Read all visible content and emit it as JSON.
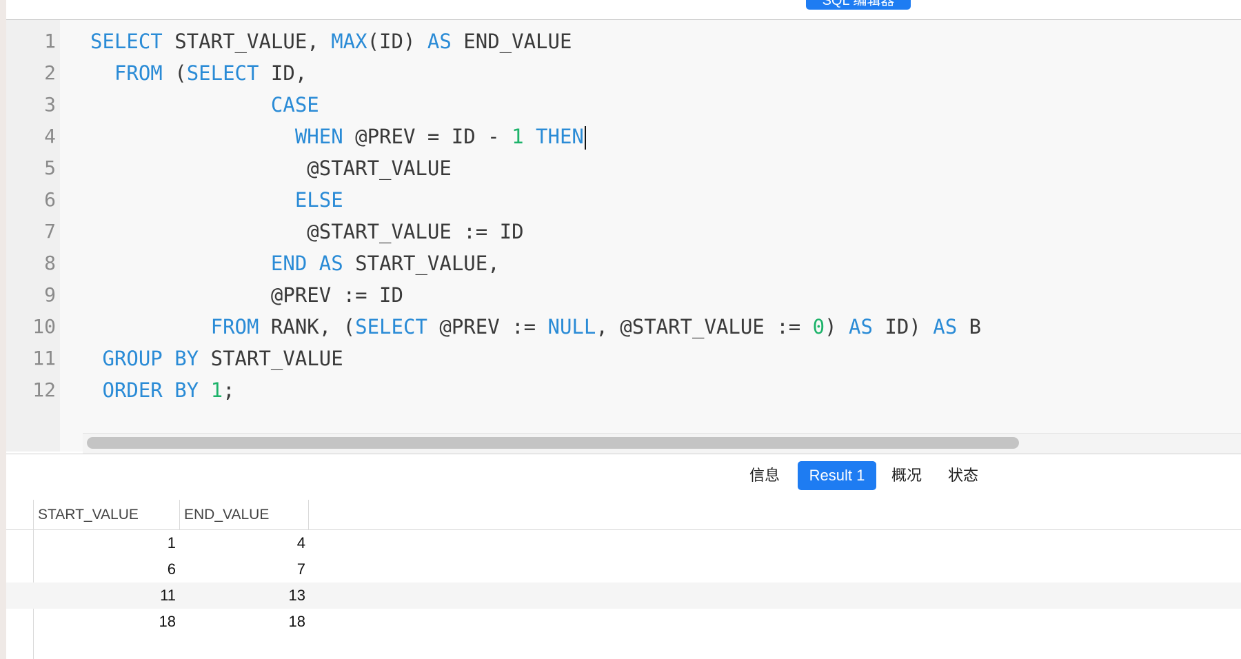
{
  "toolbar": {
    "top_button_label": "SQL 编辑器"
  },
  "editor": {
    "lines": [
      {
        "n": "1",
        "tokens": [
          {
            "t": "SELECT",
            "k": "kw"
          },
          {
            "t": " START_VALUE, "
          },
          {
            "t": "MAX",
            "k": "kw"
          },
          {
            "t": "(ID) "
          },
          {
            "t": "AS",
            "k": "kw"
          },
          {
            "t": " END_VALUE"
          }
        ]
      },
      {
        "n": "2",
        "tokens": [
          {
            "t": "  "
          },
          {
            "t": "FROM",
            "k": "kw"
          },
          {
            "t": " ("
          },
          {
            "t": "SELECT",
            "k": "kw"
          },
          {
            "t": " ID,"
          }
        ]
      },
      {
        "n": "3",
        "tokens": [
          {
            "t": "               "
          },
          {
            "t": "CASE",
            "k": "kw"
          }
        ]
      },
      {
        "n": "4",
        "tokens": [
          {
            "t": "                 "
          },
          {
            "t": "WHEN",
            "k": "kw"
          },
          {
            "t": " @PREV = ID - "
          },
          {
            "t": "1",
            "k": "num"
          },
          {
            "t": " "
          },
          {
            "t": "THEN",
            "k": "kw"
          }
        ],
        "caret": true
      },
      {
        "n": "5",
        "tokens": [
          {
            "t": "                  @START_VALUE"
          }
        ]
      },
      {
        "n": "6",
        "tokens": [
          {
            "t": "                 "
          },
          {
            "t": "ELSE",
            "k": "kw"
          }
        ]
      },
      {
        "n": "7",
        "tokens": [
          {
            "t": "                  @START_VALUE := ID"
          }
        ]
      },
      {
        "n": "8",
        "tokens": [
          {
            "t": "               "
          },
          {
            "t": "END",
            "k": "kw"
          },
          {
            "t": " "
          },
          {
            "t": "AS",
            "k": "kw"
          },
          {
            "t": " START_VALUE,"
          }
        ]
      },
      {
        "n": "9",
        "tokens": [
          {
            "t": "               @PREV := ID"
          }
        ]
      },
      {
        "n": "10",
        "tokens": [
          {
            "t": "          "
          },
          {
            "t": "FROM",
            "k": "kw"
          },
          {
            "t": " RANK, ("
          },
          {
            "t": "SELECT",
            "k": "kw"
          },
          {
            "t": " @PREV := "
          },
          {
            "t": "NULL",
            "k": "kw"
          },
          {
            "t": ", @START_VALUE := "
          },
          {
            "t": "0",
            "k": "num"
          },
          {
            "t": ") "
          },
          {
            "t": "AS",
            "k": "kw"
          },
          {
            "t": " ID) "
          },
          {
            "t": "AS",
            "k": "kw"
          },
          {
            "t": " B"
          }
        ]
      },
      {
        "n": "11",
        "tokens": [
          {
            "t": " "
          },
          {
            "t": "GROUP BY",
            "k": "kw"
          },
          {
            "t": " START_VALUE"
          }
        ]
      },
      {
        "n": "12",
        "tokens": [
          {
            "t": " "
          },
          {
            "t": "ORDER BY",
            "k": "kw"
          },
          {
            "t": " "
          },
          {
            "t": "1",
            "k": "num"
          },
          {
            "t": ";"
          }
        ]
      }
    ]
  },
  "result_tabs": [
    {
      "label": "信息",
      "active": false
    },
    {
      "label": "Result 1",
      "active": true
    },
    {
      "label": "概况",
      "active": false
    },
    {
      "label": "状态",
      "active": false
    }
  ],
  "grid": {
    "columns": [
      "START_VALUE",
      "END_VALUE"
    ],
    "rows": [
      [
        "1",
        "4"
      ],
      [
        "6",
        "7"
      ],
      [
        "11",
        "13"
      ],
      [
        "18",
        "18"
      ]
    ]
  },
  "colors": {
    "accent": "#1e7cf2",
    "keyword": "#2a8bd6",
    "number": "#1db36a"
  }
}
